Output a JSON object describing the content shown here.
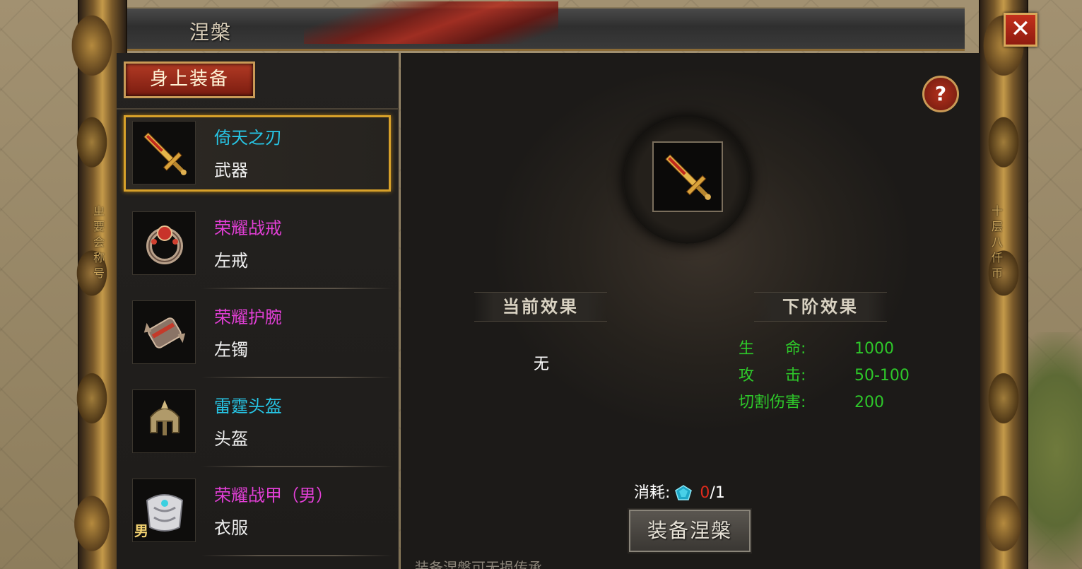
{
  "window": {
    "corner_text": "",
    "title": "涅槃",
    "close_label": "✕",
    "left_frame_text": "ㄓ要会称号",
    "right_frame_text": "十层八仟币"
  },
  "left_panel": {
    "tab_label": "身上装备",
    "items": [
      {
        "name": "倚天之刃",
        "slot": "武器",
        "name_color": "#27c6e6",
        "icon": "sword-icon",
        "selected": true
      },
      {
        "name": "荣耀战戒",
        "slot": "左戒",
        "name_color": "#e23fd6",
        "icon": "ring-icon",
        "selected": false
      },
      {
        "name": "荣耀护腕",
        "slot": "左镯",
        "name_color": "#e23fd6",
        "icon": "bracer-icon",
        "selected": false
      },
      {
        "name": "雷霆头盔",
        "slot": "头盔",
        "name_color": "#27c6e6",
        "icon": "helmet-icon",
        "selected": false
      },
      {
        "name": "荣耀战甲（男）",
        "slot": "衣服",
        "name_color": "#e23fd6",
        "icon": "armor-icon",
        "selected": false,
        "tag": "男"
      }
    ]
  },
  "right_panel": {
    "help_label": "?",
    "center_item_icon": "sword-icon",
    "current_effect_title": "当前效果",
    "next_effect_title": "下阶效果",
    "current_effect_value": "无",
    "next_stats": [
      {
        "label": "生　　命:",
        "value": "1000"
      },
      {
        "label": "攻　　击:",
        "value": "50-100"
      },
      {
        "label": "切割伤害:",
        "value": "200"
      }
    ],
    "cost_label": "消耗:",
    "cost_have": "0",
    "cost_need": "/1",
    "cost_icon": "gem-icon",
    "equip_button_label": "装备涅槃",
    "hint_text": "装备涅槃可无损传承"
  },
  "colors": {
    "stat_green": "#2ec82a",
    "selected_border": "#d8a12a",
    "cyan_name": "#27c6e6",
    "magenta_name": "#e23fd6",
    "cost_red": "#e02a1c"
  }
}
